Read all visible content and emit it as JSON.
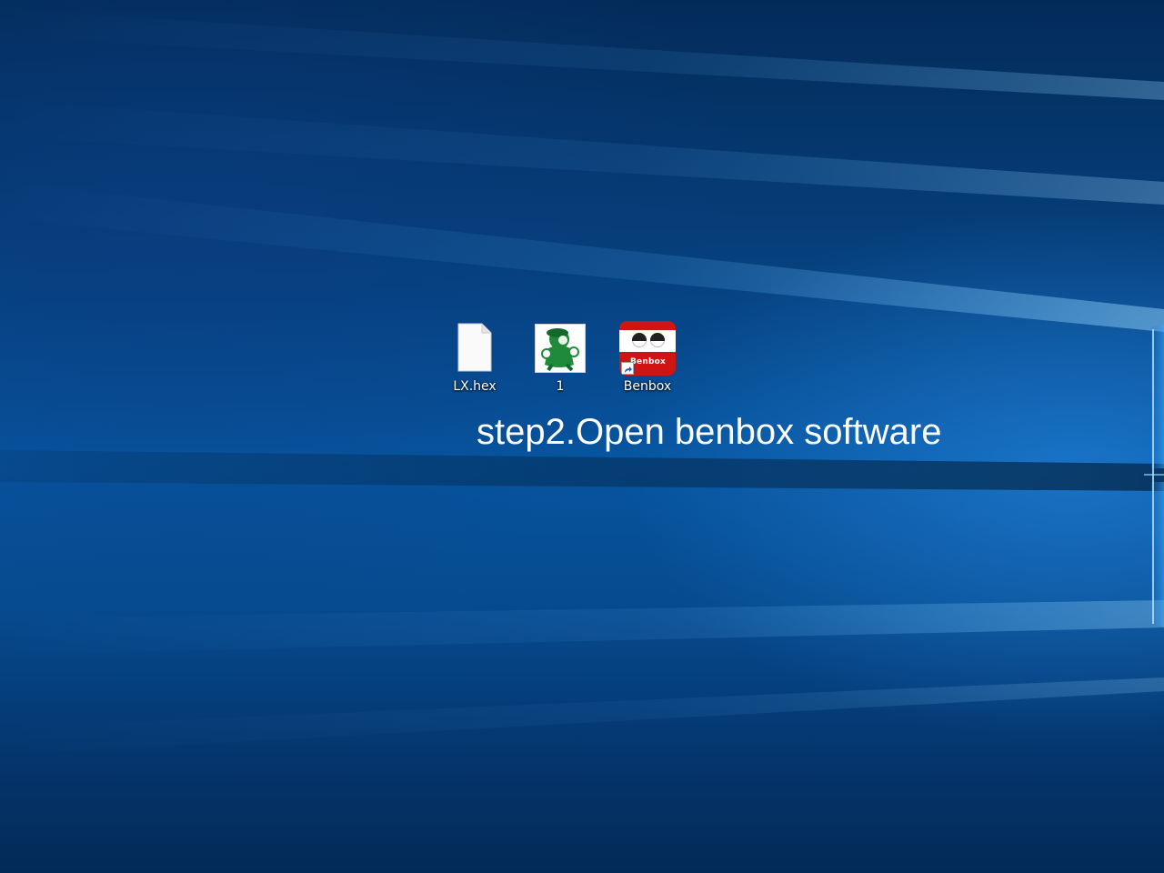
{
  "desktop": {
    "icons": [
      {
        "label": "LX.hex",
        "icon": "blank-file-icon"
      },
      {
        "label": "1",
        "icon": "mario-image-icon"
      },
      {
        "label": "Benbox",
        "icon": "benbox-app-icon",
        "icon_text": "Benbox",
        "shortcut": true
      }
    ]
  },
  "caption": {
    "text": "step2.Open benbox software"
  },
  "colors": {
    "wallpaper_dark": "#032b59",
    "wallpaper_mid": "#0755a0",
    "wallpaper_light": "#3fa8f5",
    "benbox_red": "#cf1414",
    "mario_green": "#1f8a3a"
  }
}
